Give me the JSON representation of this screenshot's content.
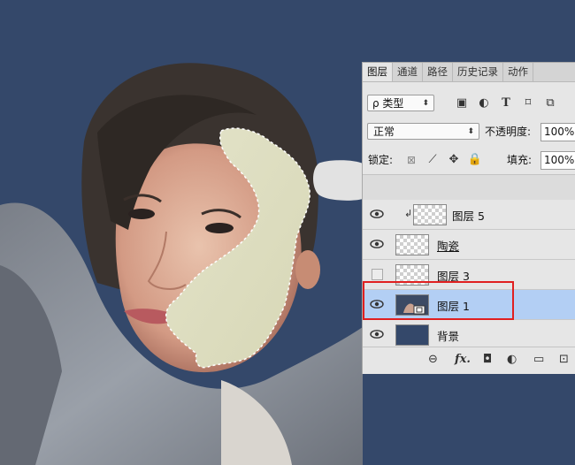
{
  "panel": {
    "tabs": [
      {
        "label": "图层",
        "active": true
      },
      {
        "label": "通道",
        "active": false
      },
      {
        "label": "路径",
        "active": false
      },
      {
        "label": "历史记录",
        "active": false
      },
      {
        "label": "动作",
        "active": false
      }
    ],
    "filter": {
      "kind_label": "ρ 类型",
      "icons": [
        "image-filter-icon",
        "adjustment-filter-icon",
        "type-filter-icon",
        "shape-filter-icon",
        "smart-object-filter-icon"
      ]
    },
    "blend": {
      "mode": "正常",
      "opacity_label": "不透明度:",
      "opacity": "100%"
    },
    "lock": {
      "label": "锁定:",
      "fill_label": "填充:",
      "fill": "100%"
    },
    "layers": [
      {
        "name": "图层 5",
        "visible": true,
        "clipped": true,
        "selected": false
      },
      {
        "name": "陶瓷",
        "visible": true,
        "clipped": false,
        "selected": false
      },
      {
        "name": "图层 3",
        "visible": false,
        "clipped": false,
        "selected": false
      },
      {
        "name": "图层 1",
        "visible": true,
        "clipped": false,
        "selected": true
      },
      {
        "name": "背景",
        "visible": true,
        "clipped": false,
        "selected": false
      }
    ],
    "bottom_icons": [
      "link-icon",
      "fx-icon",
      "mask-icon",
      "adjustment-icon",
      "group-icon",
      "new-layer-icon"
    ],
    "fx_label": "fx."
  },
  "colors": {
    "background": "#34486a",
    "highlight": "#e02020",
    "selection": "#b3cff4"
  }
}
